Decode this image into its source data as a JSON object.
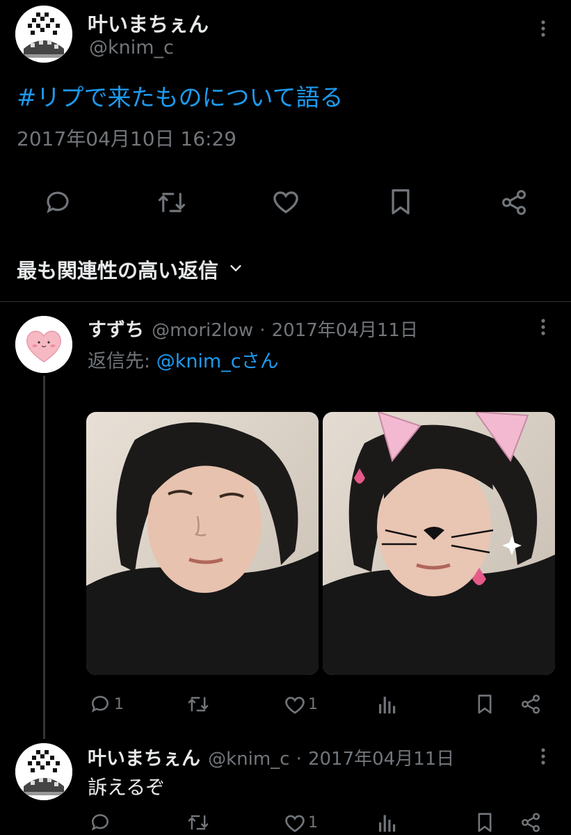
{
  "main_tweet": {
    "display_name": "叶いまちぇん",
    "handle": "@knim_c",
    "hashtag_text": "#リプで来たものについて語る",
    "timestamp": "2017年04月10日 16:29"
  },
  "sort": {
    "label": "最も関連性の高い返信"
  },
  "replies": [
    {
      "display_name": "すずち",
      "handle": "@mori2low",
      "separator": "·",
      "date": "2017年04月11日",
      "reply_to_prefix": "返信先: ",
      "reply_to_handle": "@knim_cさん",
      "reply_count": "1",
      "like_count": "1"
    },
    {
      "display_name": "叶いまちぇん",
      "handle": "@knim_c",
      "separator": "·",
      "date": "2017年04月11日",
      "text": "訴えるぞ",
      "like_count": "1"
    }
  ],
  "icons": [
    "reply-icon",
    "retweet-icon",
    "like-icon",
    "bookmark-icon",
    "share-icon",
    "views-icon",
    "more-icon",
    "chevron-down-icon"
  ],
  "colors": {
    "background": "#000000",
    "text": "#e7e9ea",
    "muted": "#71767b",
    "link": "#1d9bf0",
    "divider": "#2f3336"
  }
}
